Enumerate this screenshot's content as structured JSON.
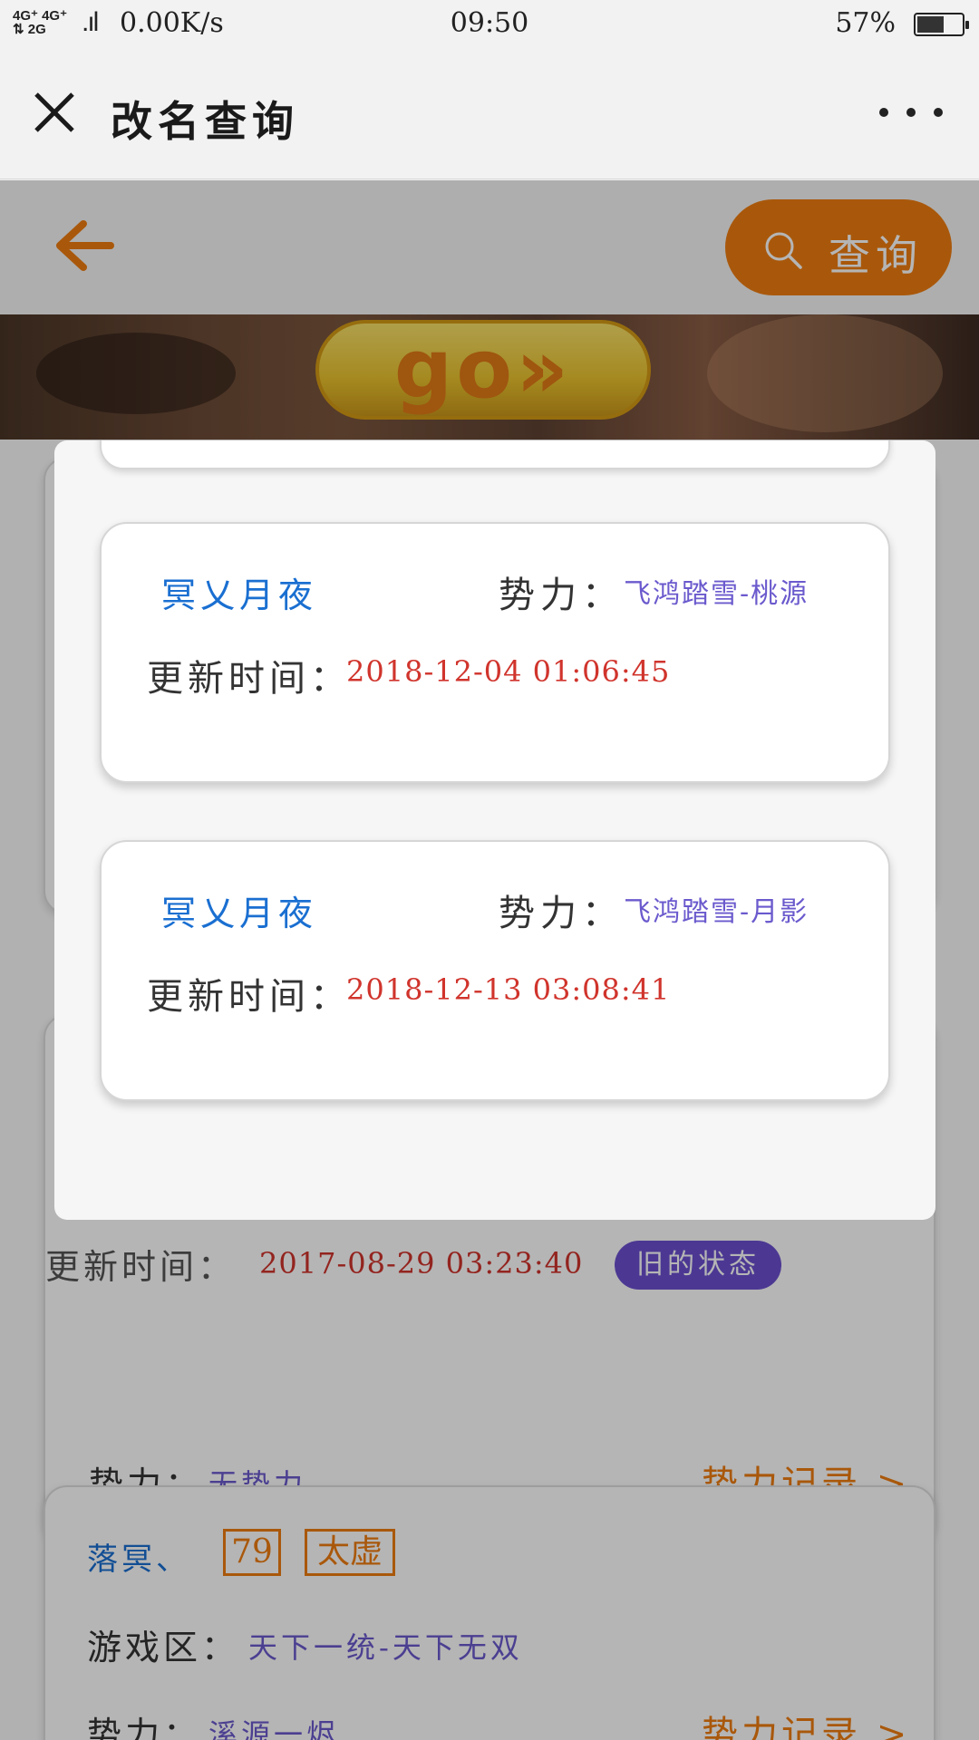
{
  "status_bar": {
    "network": "4G⁺ 4G⁺\n2G",
    "signal": "..ıl",
    "speed": "0.00K/s",
    "time": "09:50",
    "battery": "57%",
    "battery_level": 0.57
  },
  "titlebar": {
    "title": "改名查询"
  },
  "appbar": {
    "search_label": "查询"
  },
  "banner": {
    "go_text": "go»"
  },
  "background": {
    "faction_row": {
      "label": "势力：",
      "value": "无势力",
      "link": "势力记录 >"
    },
    "record": {
      "time_label": "更新时间：",
      "time_value": "2017-08-29 03:23:40",
      "status": "旧的状态",
      "name": "落冥、",
      "level": "79",
      "school": "太虚",
      "zone_label": "游戏区：",
      "zone_value": "天下一统-天下无双",
      "faction_label": "势力：",
      "faction_value": "溪源一烬",
      "link": "势力记录 >"
    }
  },
  "modal": {
    "cards": [
      {
        "name": "冥乂月夜",
        "faction_label": "势力：",
        "faction_value": "飞鸿踏雪-桃源",
        "time_label": "更新时间：",
        "time_value": "2018-12-04 01:06:45"
      },
      {
        "name": "冥乂月夜",
        "faction_label": "势力：",
        "faction_value": "飞鸿踏雪-月影",
        "time_label": "更新时间：",
        "time_value": "2018-12-13 03:08:41"
      }
    ]
  },
  "colors": {
    "accent_orange": "#ef7d10",
    "name_blue": "#1a6fd1",
    "value_purple": "#6a5acd",
    "time_red": "#d0342c",
    "status_purple": "#6b4fcf"
  }
}
